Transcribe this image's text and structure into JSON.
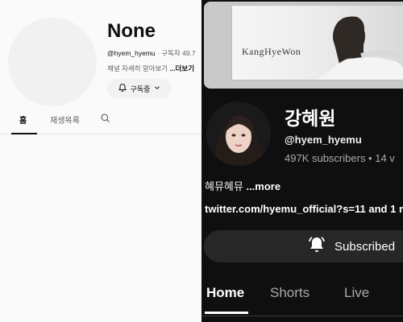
{
  "left": {
    "channel_name": "None",
    "handle": "@hyem_hyemu",
    "meta_rest": " · 구독자 49.7",
    "description": "채널 자세히 알아보기 ",
    "description_more": "...더보기",
    "subscribe_label": "구독중",
    "tabs": [
      {
        "label": "홈",
        "active": true
      },
      {
        "label": "재생목록",
        "active": false
      }
    ],
    "icons": {
      "search": "search-icon",
      "bell": "bell-icon",
      "chevron": "chevron-down-icon"
    }
  },
  "right": {
    "banner_text": "KangHyeWon",
    "channel_name": "강혜원",
    "handle": "@hyem_hyemu",
    "stats": "497K subscribers • 14 v",
    "description": "혜뮤혜뮤 ",
    "description_more": "...more",
    "link": "twitter.com/hyemu_official?s=11 and 1 m",
    "subscribed_label": "Subscribed",
    "tabs": [
      {
        "label": "Home",
        "active": true
      },
      {
        "label": "Shorts",
        "active": false
      },
      {
        "label": "Live",
        "active": false
      }
    ],
    "icons": {
      "bell": "bell-ring-icon"
    }
  },
  "colors": {
    "light_bg": "#fafafa",
    "dark_bg": "#0f0f0f",
    "button_dark": "#272727",
    "text_secondary_dark": "#aaaaaa"
  }
}
